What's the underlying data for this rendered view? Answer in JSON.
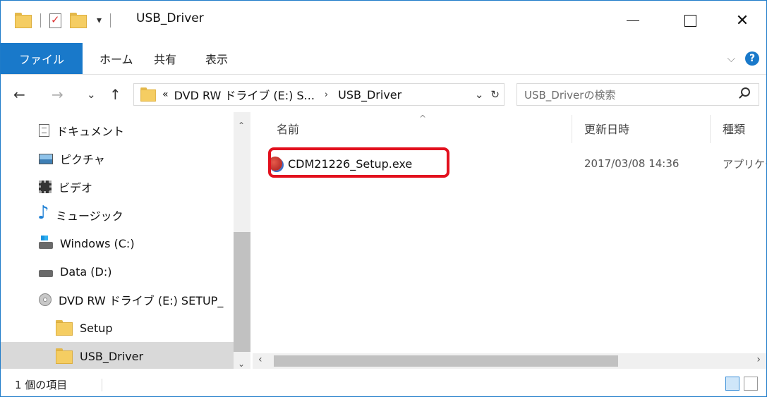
{
  "window": {
    "title": "USB_Driver",
    "qat_arrow": "▾",
    "minimize": "",
    "maximize": "",
    "close": "✕"
  },
  "ribbon": {
    "tabs": [
      "ファイル",
      "ホーム",
      "共有",
      "表示"
    ],
    "expand": "⌵",
    "help": "?"
  },
  "nav": {
    "back": "←",
    "forward": "→",
    "recent": "⌄",
    "up": "↑",
    "crumbs": [
      "«",
      "DVD RW ドライブ (E:) S...",
      "›",
      "USB_Driver"
    ],
    "dropdown": "⌄",
    "refresh": "↻",
    "search_placeholder": "USB_Driverの検索"
  },
  "sidebar": {
    "items": [
      {
        "label": "ドキュメント",
        "icon": "document-icon"
      },
      {
        "label": "ピクチャ",
        "icon": "pictures-icon"
      },
      {
        "label": "ビデオ",
        "icon": "video-icon"
      },
      {
        "label": "ミュージック",
        "icon": "music-icon"
      },
      {
        "label": "Windows (C:)",
        "icon": "windows-drive-icon"
      },
      {
        "label": "Data (D:)",
        "icon": "drive-icon"
      },
      {
        "label": "DVD RW ドライブ (E:) SETUP_",
        "icon": "dvd-drive-icon"
      },
      {
        "label": "Setup",
        "icon": "folder-icon"
      },
      {
        "label": "USB_Driver",
        "icon": "folder-icon",
        "selected": true
      }
    ],
    "scroll_up": "⌃",
    "scroll_down": "⌄"
  },
  "columns": {
    "name": "名前",
    "modified": "更新日時",
    "type": "種類",
    "sort_indicator": "^"
  },
  "files": [
    {
      "name": "CDM21226_Setup.exe",
      "modified": "2017/03/08 14:36",
      "type": "アプリケー",
      "icon": "installer-exe-icon"
    }
  ],
  "hscroll": {
    "left": "‹",
    "right": "›"
  },
  "status": {
    "item_count": "1 個の項目"
  },
  "colors": {
    "accent": "#1979ca",
    "highlight_box": "#e2101d",
    "selected_row": "#d9d9d9"
  }
}
